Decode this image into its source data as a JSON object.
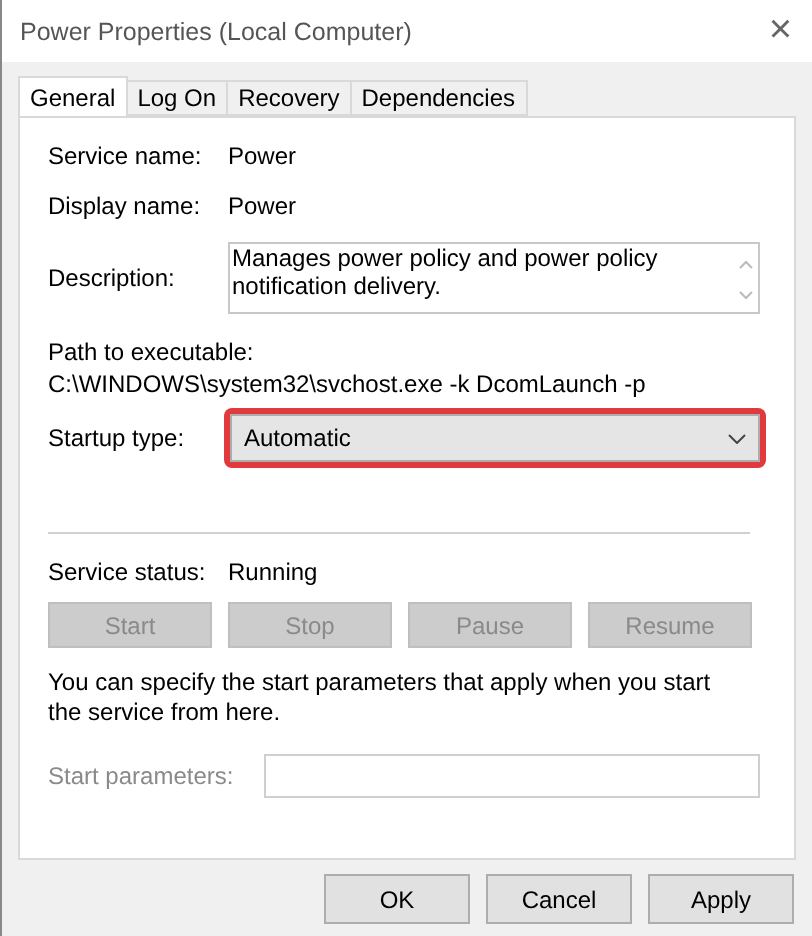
{
  "window": {
    "title": "Power Properties (Local Computer)",
    "close": "×"
  },
  "tabs": [
    {
      "label": "General",
      "selected": true
    },
    {
      "label": "Log On",
      "selected": false
    },
    {
      "label": "Recovery",
      "selected": false
    },
    {
      "label": "Dependencies",
      "selected": false
    }
  ],
  "info": [
    {
      "label": "Service name:",
      "value": "Power"
    },
    {
      "label": "Display name:",
      "value": "Power"
    }
  ],
  "description": {
    "label": "Description:",
    "value": "Manages power policy and power policy notification delivery."
  },
  "path": {
    "label": "Path to executable:",
    "value": "C:\\WINDOWS\\system32\\svchost.exe -k DcomLaunch -p"
  },
  "startup_type": {
    "label": "Startup type:",
    "value": "Automatic",
    "highlighted": true
  },
  "service_status": {
    "label": "Service status:",
    "value": "Running"
  },
  "service_buttons": [
    {
      "label": "Start",
      "disabled": true
    },
    {
      "label": "Stop",
      "disabled": true
    },
    {
      "label": "Pause",
      "disabled": true
    },
    {
      "label": "Resume",
      "disabled": true
    }
  ],
  "hint": "You can specify the start parameters that apply when you start the service from here.",
  "start_parameters": {
    "label": "Start parameters:",
    "disabled": true
  },
  "dialog_buttons": [
    {
      "label": "OK"
    },
    {
      "label": "Cancel"
    },
    {
      "label": "Apply"
    }
  ]
}
